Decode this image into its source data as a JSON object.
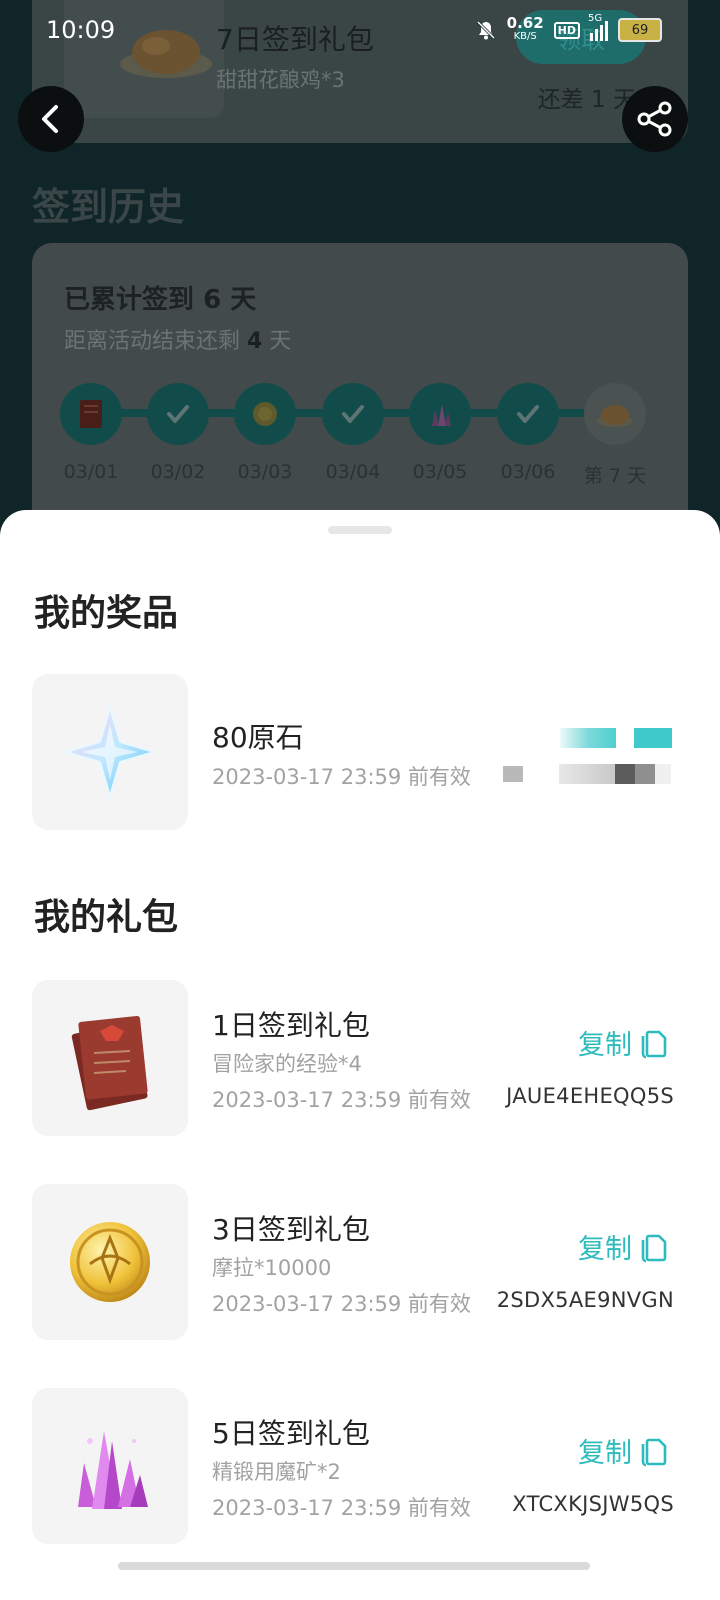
{
  "status_bar": {
    "time": "10:09",
    "net_speed": "0.62",
    "net_unit": "KB/S",
    "hd": "HD",
    "signal": "5G",
    "battery": "69"
  },
  "top_gift": {
    "title": "7日签到礼包",
    "subtitle": "甜甜花酿鸡*3",
    "claim_label": "领取",
    "remain": "还差 1 天"
  },
  "history": {
    "title": "签到历史",
    "total_prefix": "已累计签到 ",
    "total_days": "6",
    "total_suffix": " 天",
    "remain_prefix": "距离活动结束还剩 ",
    "remain_days": "4",
    "remain_suffix": " 天",
    "days": [
      {
        "label": "03/01",
        "icon": "book-icon"
      },
      {
        "label": "03/02",
        "icon": "check-icon"
      },
      {
        "label": "03/03",
        "icon": "coin-icon"
      },
      {
        "label": "03/04",
        "icon": "check-icon"
      },
      {
        "label": "03/05",
        "icon": "crystal-icon"
      },
      {
        "label": "03/06",
        "icon": "check-icon"
      },
      {
        "label": "第 7 天",
        "icon": "chicken-icon"
      }
    ]
  },
  "prizes": {
    "title": "我的奖品",
    "items": [
      {
        "name": "80原石",
        "expiry": "2023-03-17 23:59 前有效"
      }
    ]
  },
  "gifts": {
    "title": "我的礼包",
    "copy_label": "复制",
    "items": [
      {
        "name": "1日签到礼包",
        "reward": "冒险家的经验*4",
        "expiry": "2023-03-17 23:59 前有效",
        "code": "JAUE4EHEQQ5S"
      },
      {
        "name": "3日签到礼包",
        "reward": "摩拉*10000",
        "expiry": "2023-03-17 23:59 前有效",
        "code": "2SDX5AE9NVGN"
      },
      {
        "name": "5日签到礼包",
        "reward": "精锻用魔矿*2",
        "expiry": "2023-03-17 23:59 前有效",
        "code": "XTCXKJSJW5QS"
      }
    ]
  },
  "colors": {
    "accent": "#2dbbbd",
    "dim_teal": "#124c4a"
  }
}
